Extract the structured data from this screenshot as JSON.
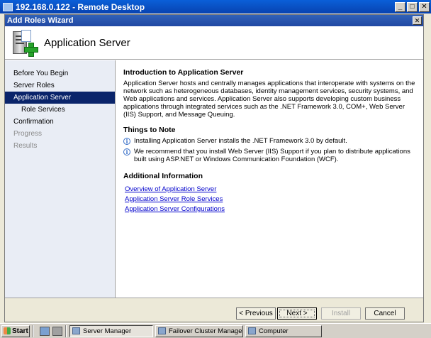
{
  "remote_desktop": {
    "title": "192.168.0.122 - Remote Desktop"
  },
  "window_buttons": {
    "minimize": "_",
    "maximize": "□",
    "close": "✕"
  },
  "wizard": {
    "title": "Add Roles Wizard",
    "close": "✕",
    "heading": "Application Server",
    "nav": [
      {
        "label": "Before You Begin",
        "state": "normal"
      },
      {
        "label": "Server Roles",
        "state": "normal"
      },
      {
        "label": "Application Server",
        "state": "selected"
      },
      {
        "label": "Role Services",
        "state": "sub"
      },
      {
        "label": "Confirmation",
        "state": "normal"
      },
      {
        "label": "Progress",
        "state": "disabled"
      },
      {
        "label": "Results",
        "state": "disabled"
      }
    ],
    "content": {
      "intro_title": "Introduction to Application Server",
      "intro_text": "Application Server hosts and centrally manages applications that interoperate with systems on the network such as heterogeneous databases, identity management services, security systems, and Web applications and services. Application Server also supports developing custom business applications through integrated services such as the .NET Framework 3.0, COM+, Web Server (IIS) Support, and Message Queuing.",
      "notes_title": "Things to Note",
      "notes": [
        "Installing Application Server installs the .NET Framework 3.0 by default.",
        "We recommend that you install Web Server (IIS) Support if you plan to distribute applications built using ASP.NET or Windows Communication Foundation (WCF)."
      ],
      "additional_title": "Additional Information",
      "links": [
        "Overview of Application Server",
        "Application Server Role Services",
        "Application Server Configurations"
      ]
    },
    "buttons": {
      "previous": "< Previous",
      "next": "Next >",
      "install": "Install",
      "cancel": "Cancel"
    }
  },
  "taskbar": {
    "start": "Start",
    "tasks": [
      {
        "label": "Server Manager",
        "active": true
      },
      {
        "label": "Failover Cluster Manage...",
        "active": false
      },
      {
        "label": "Computer",
        "active": false
      }
    ]
  }
}
